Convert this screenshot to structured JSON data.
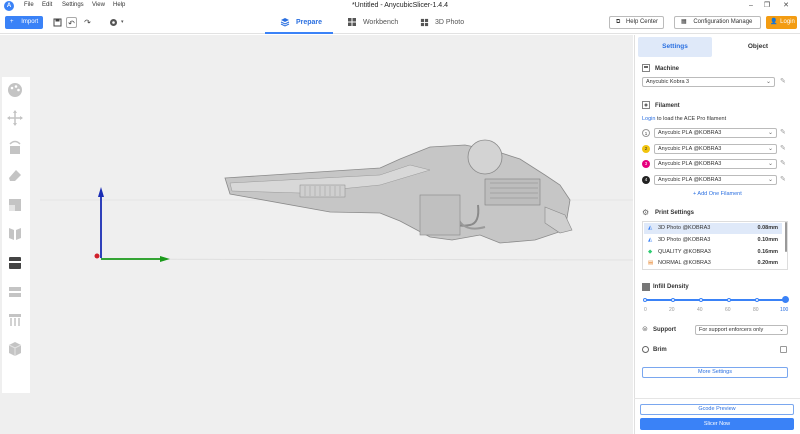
{
  "window": {
    "title": "*Untitled - AnycubicSlicer-1.4.4",
    "menu": [
      "File",
      "Edit",
      "Settings",
      "View",
      "Help"
    ]
  },
  "toolbar": {
    "import_label": "Import",
    "modes": [
      {
        "label": "Prepare",
        "icon": "cube-icon"
      },
      {
        "label": "Workbench",
        "icon": "grid-icon"
      },
      {
        "label": "3D Photo",
        "icon": "grid-small-icon"
      }
    ],
    "help_label": "Help Center",
    "config_label": "Configuration Manage",
    "login_label": "Login"
  },
  "panel": {
    "tabs": [
      "Settings",
      "Object"
    ],
    "machine": {
      "title": "Machine",
      "value": "Anycubic Kobra 3"
    },
    "filament": {
      "title": "Filament",
      "login_link": "Login",
      "login_text": "to load the ACE Pro filament",
      "slots": [
        {
          "num": "1",
          "color": "#ffffff",
          "value": "Anycubic PLA @KOBRA3"
        },
        {
          "num": "2",
          "color": "#f1c40f",
          "value": "Anycubic PLA @KOBRA3"
        },
        {
          "num": "3",
          "color": "#e6007e",
          "value": "Anycubic PLA @KOBRA3"
        },
        {
          "num": "4",
          "color": "#222222",
          "value": "Anycubic PLA @KOBRA3"
        }
      ],
      "add_label": "+ Add One Filament"
    },
    "print_settings": {
      "title": "Print Settings",
      "rows": [
        {
          "name": "3D Photo @KOBRA3",
          "value": "0.08mm",
          "selected": true
        },
        {
          "name": "3D Photo @KOBRA3",
          "value": "0.10mm",
          "selected": false
        },
        {
          "name": "QUALITY @KOBRA3",
          "value": "0.16mm",
          "selected": false
        },
        {
          "name": "NORMAL @KOBRA3",
          "value": "0.20mm",
          "selected": false
        }
      ]
    },
    "infill": {
      "title": "Infill Density",
      "ticks": [
        "0",
        "20",
        "40",
        "60",
        "80",
        "100"
      ],
      "value": 100
    },
    "support": {
      "title": "Support",
      "value": "For support enforcers only"
    },
    "brim": {
      "title": "Brim"
    },
    "more_settings": "More Settings",
    "gcode_preview": "Gcode Preview",
    "slice_now": "Slicer Now"
  },
  "colors": {
    "accent": "#3a82f7",
    "login": "#f39c12",
    "viewport_bg": "#efefef"
  }
}
